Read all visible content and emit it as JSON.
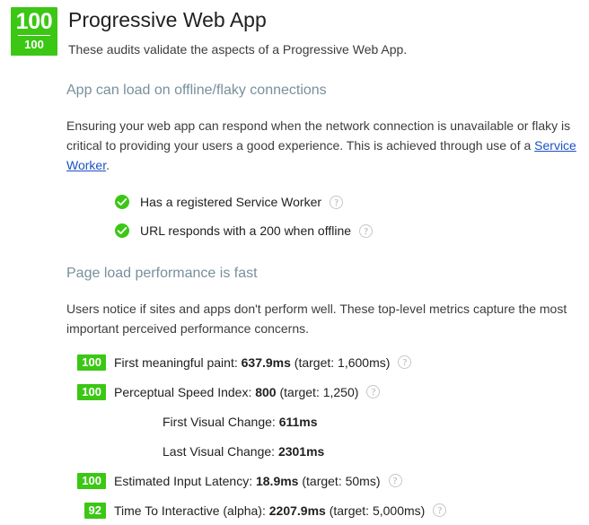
{
  "header": {
    "score": "100",
    "score_sub": "100",
    "title": "Progressive Web App",
    "description": "These audits validate the aspects of a Progressive Web App."
  },
  "colors": {
    "pass_green": "#3bc714",
    "section_heading": "#78909c",
    "link_blue": "#1a52c4",
    "body_text": "#212121"
  },
  "sections": [
    {
      "title": "App can load on offline/flaky connections",
      "desc_part1": "Ensuring your web app can respond when the network connection is unavailable or flaky is critical to providing your users a good experience. This is achieved through use of a ",
      "link_text": "Service Worker",
      "desc_part2": ".",
      "audits": [
        {
          "icon": "check-circle-icon",
          "label": "Has a registered Service Worker",
          "help": "?"
        },
        {
          "icon": "check-circle-icon",
          "label": "URL responds with a 200 when offline",
          "help": "?"
        }
      ]
    },
    {
      "title": "Page load performance is fast",
      "desc": "Users notice if sites and apps don't perform well. These top-level metrics capture the most important perceived performance concerns.",
      "metrics": [
        {
          "badge": "100",
          "name": "First meaningful paint: ",
          "value": "637.9ms",
          "target": " (target: 1,600ms)",
          "help": "?"
        },
        {
          "badge": "100",
          "name": "Perceptual Speed Index: ",
          "value": "800",
          "target": " (target: 1,250)",
          "help": "?"
        },
        {
          "badge": "100",
          "name": "Estimated Input Latency: ",
          "value": "18.9ms",
          "target": " (target: 50ms)",
          "help": "?"
        },
        {
          "badge": "92",
          "name": "Time To Interactive (alpha): ",
          "value": "2207.9ms",
          "target": " (target: 5,000ms)",
          "help": "?"
        }
      ],
      "subitems": [
        {
          "name": "First Visual Change: ",
          "value": "611ms"
        },
        {
          "name": "Last Visual Change: ",
          "value": "2301ms"
        }
      ]
    }
  ]
}
